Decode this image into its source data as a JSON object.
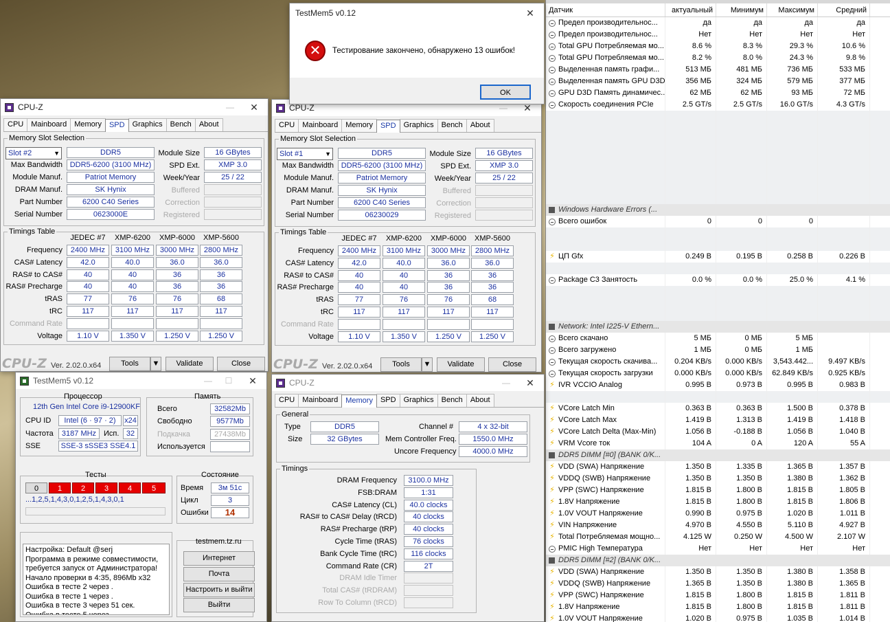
{
  "dialog": {
    "title": "TestMem5 v0.12",
    "message": "Тестирование закончено, обнаружено 13 ошибок!",
    "ok": "OK"
  },
  "cpuz_common": {
    "title": "CPU-Z",
    "tabs": [
      "CPU",
      "Mainboard",
      "Memory",
      "SPD",
      "Graphics",
      "Bench",
      "About"
    ],
    "logo": "CPU-Z",
    "version": "Ver. 2.02.0.x64",
    "tools": "Tools",
    "validate": "Validate",
    "close": "Close",
    "spd_group": "Memory Slot Selection",
    "timings_group": "Timings Table",
    "labels": {
      "module_size": "Module Size",
      "max_bw": "Max Bandwidth",
      "spd_ext": "SPD Ext.",
      "manuf": "Module Manuf.",
      "week": "Week/Year",
      "dram_manuf": "DRAM Manuf.",
      "buffered": "Buffered",
      "part": "Part Number",
      "correction": "Correction",
      "serial": "Serial Number",
      "registered": "Registered"
    },
    "timing_cols": [
      "JEDEC #7",
      "XMP-6200",
      "XMP-6000",
      "XMP-5600"
    ],
    "timing_rows": [
      "Frequency",
      "CAS# Latency",
      "RAS# to CAS#",
      "RAS# Precharge",
      "tRAS",
      "tRC",
      "Command Rate",
      "Voltage"
    ],
    "timing_vals": [
      [
        "2400 MHz",
        "3100 MHz",
        "3000 MHz",
        "2800 MHz"
      ],
      [
        "42.0",
        "40.0",
        "36.0",
        "36.0"
      ],
      [
        "40",
        "40",
        "36",
        "36"
      ],
      [
        "40",
        "40",
        "36",
        "36"
      ],
      [
        "77",
        "76",
        "76",
        "68"
      ],
      [
        "117",
        "117",
        "117",
        "117"
      ],
      [
        "",
        "",
        "",
        ""
      ],
      [
        "1.10 V",
        "1.350 V",
        "1.250 V",
        "1.250 V"
      ]
    ]
  },
  "spd2": {
    "slot": "Slot #2",
    "type": "DDR5",
    "size": "16 GBytes",
    "bw": "DDR5-6200 (3100 MHz)",
    "ext": "XMP 3.0",
    "manuf": "Patriot Memory",
    "week": "25 / 22",
    "dram": "SK Hynix",
    "part": "6200 C40 Series",
    "serial": "0623000E"
  },
  "spd1": {
    "slot": "Slot #1",
    "type": "DDR5",
    "size": "16 GBytes",
    "bw": "DDR5-6200 (3100 MHz)",
    "ext": "XMP 3.0",
    "manuf": "Patriot Memory",
    "week": "25 / 22",
    "dram": "SK Hynix",
    "part": "6200 C40 Series",
    "serial": "06230029"
  },
  "mem": {
    "general": "General",
    "type_l": "Type",
    "type": "DDR5",
    "size_l": "Size",
    "size": "32 GBytes",
    "channel_l": "Channel #",
    "channel": "4 x 32-bit",
    "mcf_l": "Mem Controller Freq.",
    "mcf": "1550.0 MHz",
    "unc_l": "Uncore Frequency",
    "unc": "4000.0 MHz",
    "timings": "Timings",
    "rows": [
      [
        "DRAM Frequency",
        "3100.0 MHz"
      ],
      [
        "FSB:DRAM",
        "1:31"
      ],
      [
        "CAS# Latency (CL)",
        "40.0 clocks"
      ],
      [
        "RAS# to CAS# Delay (tRCD)",
        "40 clocks"
      ],
      [
        "RAS# Precharge (tRP)",
        "40 clocks"
      ],
      [
        "Cycle Time (tRAS)",
        "76 clocks"
      ],
      [
        "Bank Cycle Time (tRC)",
        "116 clocks"
      ],
      [
        "Command Rate (CR)",
        "2T"
      ],
      [
        "DRAM Idle Timer",
        ""
      ],
      [
        "Total CAS# (tRDRAM)",
        ""
      ],
      [
        "Row To Column (tRCD)",
        ""
      ]
    ]
  },
  "tm": {
    "title": "TestMem5 v0.12",
    "cpu_h": "Процессор",
    "cpu": "12th Gen Intel Core i9-12900KF",
    "cpuid_l": "CPU ID",
    "cpuid": "Intel (6 · 97 · 2)",
    "threads": "x24",
    "freq_l": "Частота",
    "freq": "3187 MHz",
    "use_l": "Исп.",
    "use": "32",
    "sse_l": "SSE",
    "sse": "SSE-3 sSSE3 SSE4.1",
    "mem_h": "Память",
    "total_l": "Всего",
    "total": "32582Mb",
    "free_l": "Свободно",
    "free": "9577Mb",
    "page_l": "Подкачка",
    "page": "27438Mb",
    "used_l": "Используется",
    "tests_h": "Тесты",
    "tests": [
      "0",
      "1",
      "2",
      "3",
      "4",
      "5"
    ],
    "seq": "...1,2,5,1,4,3,0,1,2,5,1,4,3,0,1",
    "state_h": "Состояние",
    "time_l": "Время",
    "time": "3м 51с",
    "cycle_l": "Цикл",
    "cycle": "3",
    "err_l": "Ошибки",
    "err": "14",
    "log": "Настройка: Default @serj\nПрограмма в режиме совместимости,\nтребуется запуск от Администратора!\nНачало проверки в 4:35, 896Mb x32\nОшибка в тесте 2 через .\nОшибка в тесте 1 через .\nОшибка в тесте 3 через 51 сек.\nОшибка в тесте 5 через .",
    "site": "testmem.tz.ru",
    "b1": "Интернет",
    "b2": "Почта",
    "b3": "Настроить и выйти",
    "b4": "Выйти"
  },
  "hw": {
    "head": [
      "Датчик",
      "актуальный",
      "Минимум",
      "Максимум",
      "Средний"
    ],
    "rows": [
      [
        "c",
        "Предел производительнос...",
        "да",
        "да",
        "да",
        "да"
      ],
      [
        "c",
        "Предел производительнос...",
        "Нет",
        "Нет",
        "Нет",
        "Нет"
      ],
      [
        "c",
        "Total GPU Потребляемая мо...",
        "8.6 %",
        "8.3 %",
        "29.3 %",
        "10.6 %"
      ],
      [
        "c",
        "Total GPU Потребляемая мо...",
        "8.2 %",
        "8.0 %",
        "24.3 %",
        "9.8 %"
      ],
      [
        "c",
        "Выделенная память графи...",
        "513 МБ",
        "481 МБ",
        "736 МБ",
        "533 МБ"
      ],
      [
        "c",
        "Выделенная память GPU D3D",
        "356 МБ",
        "324 МБ",
        "579 МБ",
        "377 МБ"
      ],
      [
        "c",
        "GPU D3D Память динамичес...",
        "62 МБ",
        "62 МБ",
        "93 МБ",
        "72 МБ"
      ],
      [
        "c",
        "Скорость соединения PCIe",
        "2.5 GT/s",
        "2.5 GT/s",
        "16.0 GT/s",
        "4.3 GT/s"
      ],
      [
        "e"
      ],
      [
        "e"
      ],
      [
        "e"
      ],
      [
        "e"
      ],
      [
        "e"
      ],
      [
        "e"
      ],
      [
        "e"
      ],
      [
        "e"
      ],
      [
        "h",
        "Windows Hardware Errors (..."
      ],
      [
        "c",
        "Всего ошибок",
        "0",
        "0",
        "0",
        ""
      ],
      [
        "e"
      ],
      [
        "e"
      ],
      [
        "b",
        "ЦП Gfx",
        "0.249 В",
        "0.195 В",
        "0.258 В",
        "0.226 В"
      ],
      [
        "e"
      ],
      [
        "c",
        "Package C3 Занятость",
        "0.0 %",
        "0.0 %",
        "25.0 %",
        "4.1 %"
      ],
      [
        "e"
      ],
      [
        "e"
      ],
      [
        "e"
      ],
      [
        "h",
        "Network: Intel I225-V Ethern..."
      ],
      [
        "c",
        "Всего скачано",
        "5 МБ",
        "0 МБ",
        "5 МБ",
        ""
      ],
      [
        "c",
        "Всего загружено",
        "1 МБ",
        "0 МБ",
        "1 МБ",
        ""
      ],
      [
        "c",
        "Текущая скорость скачива...",
        "0.204 KB/s",
        "0.000 KB/s",
        "3,543.442...",
        "9.497 KB/s"
      ],
      [
        "c",
        "Текущая скорость загрузки",
        "0.000 KB/s",
        "0.000 KB/s",
        "62.849 KB/s",
        "0.925 KB/s"
      ],
      [
        "b",
        "IVR VCCIO Analog",
        "0.995 В",
        "0.973 В",
        "0.995 В",
        "0.983 В"
      ],
      [
        "e"
      ],
      [
        "b",
        "VCore Latch Min",
        "0.363 В",
        "0.363 В",
        "1.500 В",
        "0.378 В"
      ],
      [
        "b",
        "VCore Latch Max",
        "1.419 В",
        "1.313 В",
        "1.419 В",
        "1.418 В"
      ],
      [
        "b",
        "VCore Latch Delta (Max-Min)",
        "1.056 В",
        "-0.188 В",
        "1.056 В",
        "1.040 В"
      ],
      [
        "b",
        "VRM Vcore ток",
        "104 A",
        "0 A",
        "120 A",
        "55 A"
      ],
      [
        "h",
        "DDR5 DIMM [#0] (BANK 0/K..."
      ],
      [
        "b",
        "VDD (SWA) Напряжение",
        "1.350 В",
        "1.335 В",
        "1.365 В",
        "1.357 В"
      ],
      [
        "b",
        "VDDQ (SWB) Напряжение",
        "1.350 В",
        "1.350 В",
        "1.380 В",
        "1.362 В"
      ],
      [
        "b",
        "VPP (SWC) Напряжение",
        "1.815 В",
        "1.800 В",
        "1.815 В",
        "1.805 В"
      ],
      [
        "b",
        "1.8V Напряжение",
        "1.815 В",
        "1.800 В",
        "1.815 В",
        "1.806 В"
      ],
      [
        "b",
        "1.0V VOUT Напряжение",
        "0.990 В",
        "0.975 В",
        "1.020 В",
        "1.011 В"
      ],
      [
        "b",
        "VIN Напряжение",
        "4.970 В",
        "4.550 В",
        "5.110 В",
        "4.927 В"
      ],
      [
        "b",
        "Total Потребляемая мощно...",
        "4.125 W",
        "0.250 W",
        "4.500 W",
        "2.107 W"
      ],
      [
        "c",
        "PMIC High Температура",
        "Нет",
        "Нет",
        "Нет",
        "Нет"
      ],
      [
        "h",
        "DDR5 DIMM [#2] (BANK 0/K..."
      ],
      [
        "b",
        "VDD (SWA) Напряжение",
        "1.350 В",
        "1.350 В",
        "1.380 В",
        "1.358 В"
      ],
      [
        "b",
        "VDDQ (SWB) Напряжение",
        "1.365 В",
        "1.350 В",
        "1.380 В",
        "1.365 В"
      ],
      [
        "b",
        "VPP (SWC) Напряжение",
        "1.815 В",
        "1.800 В",
        "1.815 В",
        "1.811 В"
      ],
      [
        "b",
        "1.8V Напряжение",
        "1.815 В",
        "1.800 В",
        "1.815 В",
        "1.811 В"
      ],
      [
        "b",
        "1.0V VOUT Напряжение",
        "1.020 В",
        "0.975 В",
        "1.035 В",
        "1.014 В"
      ]
    ]
  }
}
